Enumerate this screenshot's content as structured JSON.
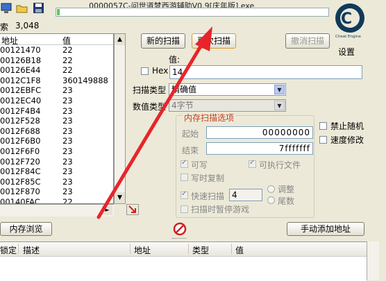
{
  "window": {
    "title": "0000057C-问世道梦西游辅助V0.9[庆年版].exe",
    "progress_fraction": 0.01
  },
  "found": {
    "label": "索",
    "count": "3,048"
  },
  "list": {
    "headers": [
      "地址",
      "值"
    ],
    "rows": [
      [
        "00121470",
        "22"
      ],
      [
        "00126B18",
        "22"
      ],
      [
        "00126E44",
        "22"
      ],
      [
        "0012C1F8",
        "360149888"
      ],
      [
        "0012EBFC",
        "23"
      ],
      [
        "0012EC40",
        "23"
      ],
      [
        "0012F4B4",
        "23"
      ],
      [
        "0012F528",
        "23"
      ],
      [
        "0012F688",
        "23"
      ],
      [
        "0012F6B0",
        "23"
      ],
      [
        "0012F6F0",
        "23"
      ],
      [
        "0012F720",
        "23"
      ],
      [
        "0012F84C",
        "23"
      ],
      [
        "0012F85C",
        "23"
      ],
      [
        "0012F870",
        "23"
      ],
      [
        "00140FAC",
        "22"
      ]
    ]
  },
  "buttons": {
    "new_scan": "新的扫描",
    "next_scan": "再次扫描",
    "undo_scan": "撤消扫描",
    "memory_view": "内存浏览",
    "add_address": "手动添加地址"
  },
  "settings_label": "设置",
  "logo_label": "Cheat Engine",
  "value_label": "值:",
  "hex_label": "Hex",
  "value_input": "14",
  "scan_type": {
    "label": "扫描类型",
    "value": "精确值"
  },
  "value_type": {
    "label": "数值类型",
    "value": "4字节"
  },
  "memory_options": {
    "title": "内存扫描选项",
    "start_label": "起始",
    "start_value": "00000000",
    "end_label": "结束",
    "end_value": "7fffffff",
    "writable": "可写",
    "executable": "可执行文件",
    "copy_on_write": "写时复制",
    "fast_scan": "快速扫描",
    "fast_scan_value": "4",
    "align": "调整",
    "last_digits": "尾数",
    "pause_scan": "扫描时暂停游戏"
  },
  "side_options": {
    "disable_random": "禁止随机",
    "speed_modify": "速度修改"
  },
  "bottom_table": {
    "headers": [
      "锁定",
      "描述",
      "地址",
      "类型",
      "值"
    ]
  },
  "colors": {
    "arrow": "#e8242a",
    "progress": "#5ec55e",
    "window_bg": "#ece9d8"
  }
}
